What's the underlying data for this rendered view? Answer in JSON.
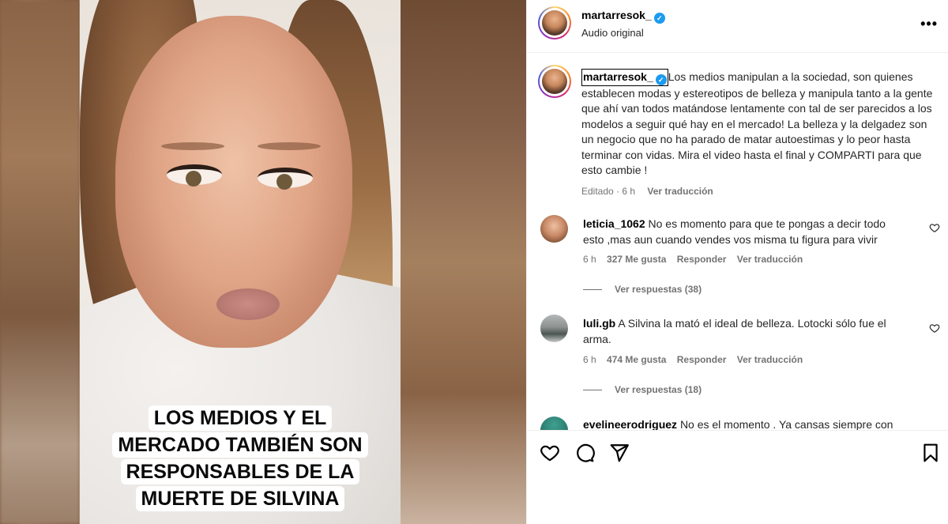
{
  "video": {
    "overlay_lines": [
      "LOS MEDIOS Y EL",
      "MERCADO TAMBIÉN SON",
      "RESPONSABLES DE LA",
      "MUERTE DE SILVINA"
    ]
  },
  "header": {
    "username": "martarresok_",
    "audio": "Audio original",
    "more": "•••"
  },
  "caption": {
    "username": "martarresok_",
    "text": "Los medios manipulan a la sociedad, son quienes establecen modas y estereotipos de belleza y manipula tanto a la gente que ahí van todos matándose lentamente con tal de ser parecidos a los modelos a seguir qué hay en el mercado! La belleza y la delgadez son un negocio que no ha parado de matar autoestimas y lo peor hasta terminar con vidas. Mira el video hasta el final y COMPARTI para que esto cambie !",
    "edited": "Editado · 6 h",
    "translate": "Ver traducción"
  },
  "comments": [
    {
      "username": "leticia_1062",
      "text": "No es momento para que te pongas a decir todo esto ,mas aun cuando vendes vos misma tu figura para vivir",
      "time": "6 h",
      "likes": "327 Me gusta",
      "reply": "Responder",
      "translate": "Ver traducción",
      "replies": "Ver respuestas (38)"
    },
    {
      "username": "luli.gb",
      "text": "A Silvina la mató el ideal de belleza. Lotocki sólo fue el arma.",
      "time": "6 h",
      "likes": "474 Me gusta",
      "reply": "Responder",
      "translate": "Ver traducción",
      "replies": "Ver respuestas (18)"
    },
    {
      "username": "evelineerodriguez",
      "text": "No es el momento . Ya cansas siempre con"
    }
  ],
  "icons": {
    "like": "heart-icon",
    "comment": "comment-icon",
    "share": "paper-plane-icon",
    "save": "bookmark-icon",
    "verified": "verified-badge-icon"
  },
  "colors": {
    "verified": "#1d9bf0",
    "muted_text": "#737373",
    "overlay_bg": "#ffffff"
  }
}
